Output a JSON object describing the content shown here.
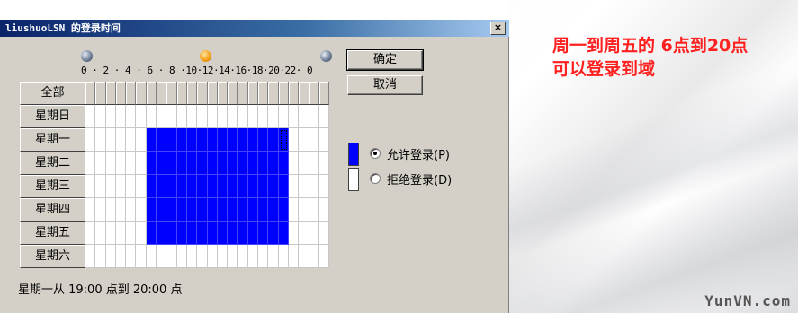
{
  "dialog": {
    "title": "liushuoLSN 的登录时间",
    "close_label": "×",
    "hour_labels": "0 · 2 · 4 · 6 · 8 ·10·12·14·16·18·20·22· 0",
    "all_label": "全部",
    "days": [
      "星期日",
      "星期一",
      "星期二",
      "星期三",
      "星期四",
      "星期五",
      "星期六"
    ],
    "allowed_hours": {
      "days": [
        1,
        2,
        3,
        4,
        5
      ],
      "from": 6,
      "to": 20
    },
    "focus_cell": {
      "day": 1,
      "hour": 19
    },
    "ok_label": "确定",
    "cancel_label": "取消",
    "allow_label": "允许登录(P)",
    "deny_label": "拒绝登录(D)",
    "selected_option": "allow",
    "status_text": "星期一从 19:00 点到 20:00 点",
    "colors": {
      "allowed": "#0000ff",
      "denied": "#ffffff"
    }
  },
  "note": {
    "line1": "周一到周五的 6点到20点",
    "line2": "可以登录到域"
  },
  "watermark": "YunVN.com"
}
